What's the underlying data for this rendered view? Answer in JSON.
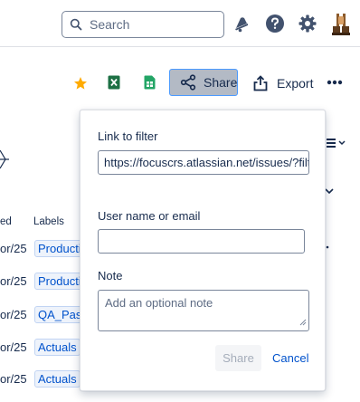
{
  "header": {
    "search_placeholder": "Search",
    "icons": [
      "search-icon",
      "notifications-icon",
      "help-icon",
      "settings-icon",
      "avatar"
    ]
  },
  "toolbar": {
    "star_icon": "star-icon",
    "excel_icon": "excel-export-icon",
    "sheets_icon": "google-sheets-icon",
    "share_label": "Share",
    "export_label": "Export",
    "more_icon": "more-icon"
  },
  "background": {
    "columns": [
      "ed",
      "Labels"
    ],
    "rows": [
      {
        "date": "or/25",
        "label": "Producti"
      },
      {
        "date": "or/25",
        "label": "Producti"
      },
      {
        "date": "or/25",
        "label": "QA_Pass"
      },
      {
        "date": "or/25",
        "label": "Actuals"
      },
      {
        "date": "or/25",
        "label": "Actuals"
      }
    ]
  },
  "share_dialog": {
    "link_label": "Link to filter",
    "link_value": "https://focuscrs.atlassian.net/issues/?filt",
    "user_label": "User name or email",
    "user_value": "",
    "note_label": "Note",
    "note_placeholder": "Add an optional note",
    "share_button": "Share",
    "cancel_button": "Cancel"
  },
  "colors": {
    "link": "#0052cc",
    "share_active_bg": "#b3bac5",
    "focus_border": "#4c9aff",
    "star": "#ffab00"
  }
}
